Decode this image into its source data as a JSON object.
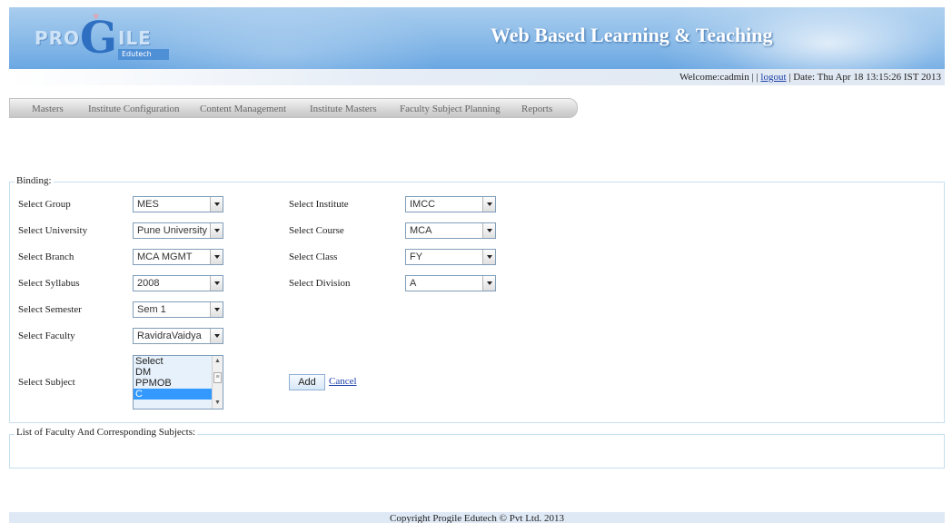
{
  "header": {
    "logo": {
      "pro": "PRO",
      "g": "G",
      "ile": "ILE",
      "edutech": "Edutech"
    },
    "site_title": "Web Based Learning & Teaching"
  },
  "welcome": {
    "prefix": "Welcome:cadmin | |",
    "logout": "logout",
    "date": "| Date: Thu Apr 18 13:15:26 IST 2013"
  },
  "nav": {
    "items": [
      "Masters",
      "Institute Configuration",
      "Content Management",
      "Institute Masters",
      "Faculty Subject Planning",
      "Reports"
    ]
  },
  "binding": {
    "legend": "Binding:",
    "left": [
      {
        "label": "Select Group",
        "value": "MES"
      },
      {
        "label": "Select University",
        "value": "Pune University"
      },
      {
        "label": "Select Branch",
        "value": "MCA MGMT"
      },
      {
        "label": "Select Syllabus",
        "value": "2008"
      },
      {
        "label": "Select Semester",
        "value": "Sem 1"
      },
      {
        "label": "Select Faculty",
        "value": "RavidraVaidya"
      }
    ],
    "right": [
      {
        "label": "Select Institute",
        "value": "IMCC"
      },
      {
        "label": "Select Course",
        "value": "MCA"
      },
      {
        "label": "Select Class",
        "value": "FY"
      },
      {
        "label": "Select Division",
        "value": "A"
      }
    ],
    "subject": {
      "label": "Select Subject",
      "options": [
        "Select",
        "DM",
        "PPMOB",
        "C"
      ],
      "selected": "C"
    },
    "add_label": "Add",
    "cancel_label": "Cancel"
  },
  "list": {
    "legend": "List of Faculty And Corresponding Subjects:"
  },
  "footer": {
    "copyright": "Copyright Progile Edutech © Pvt Ltd. 2013"
  }
}
